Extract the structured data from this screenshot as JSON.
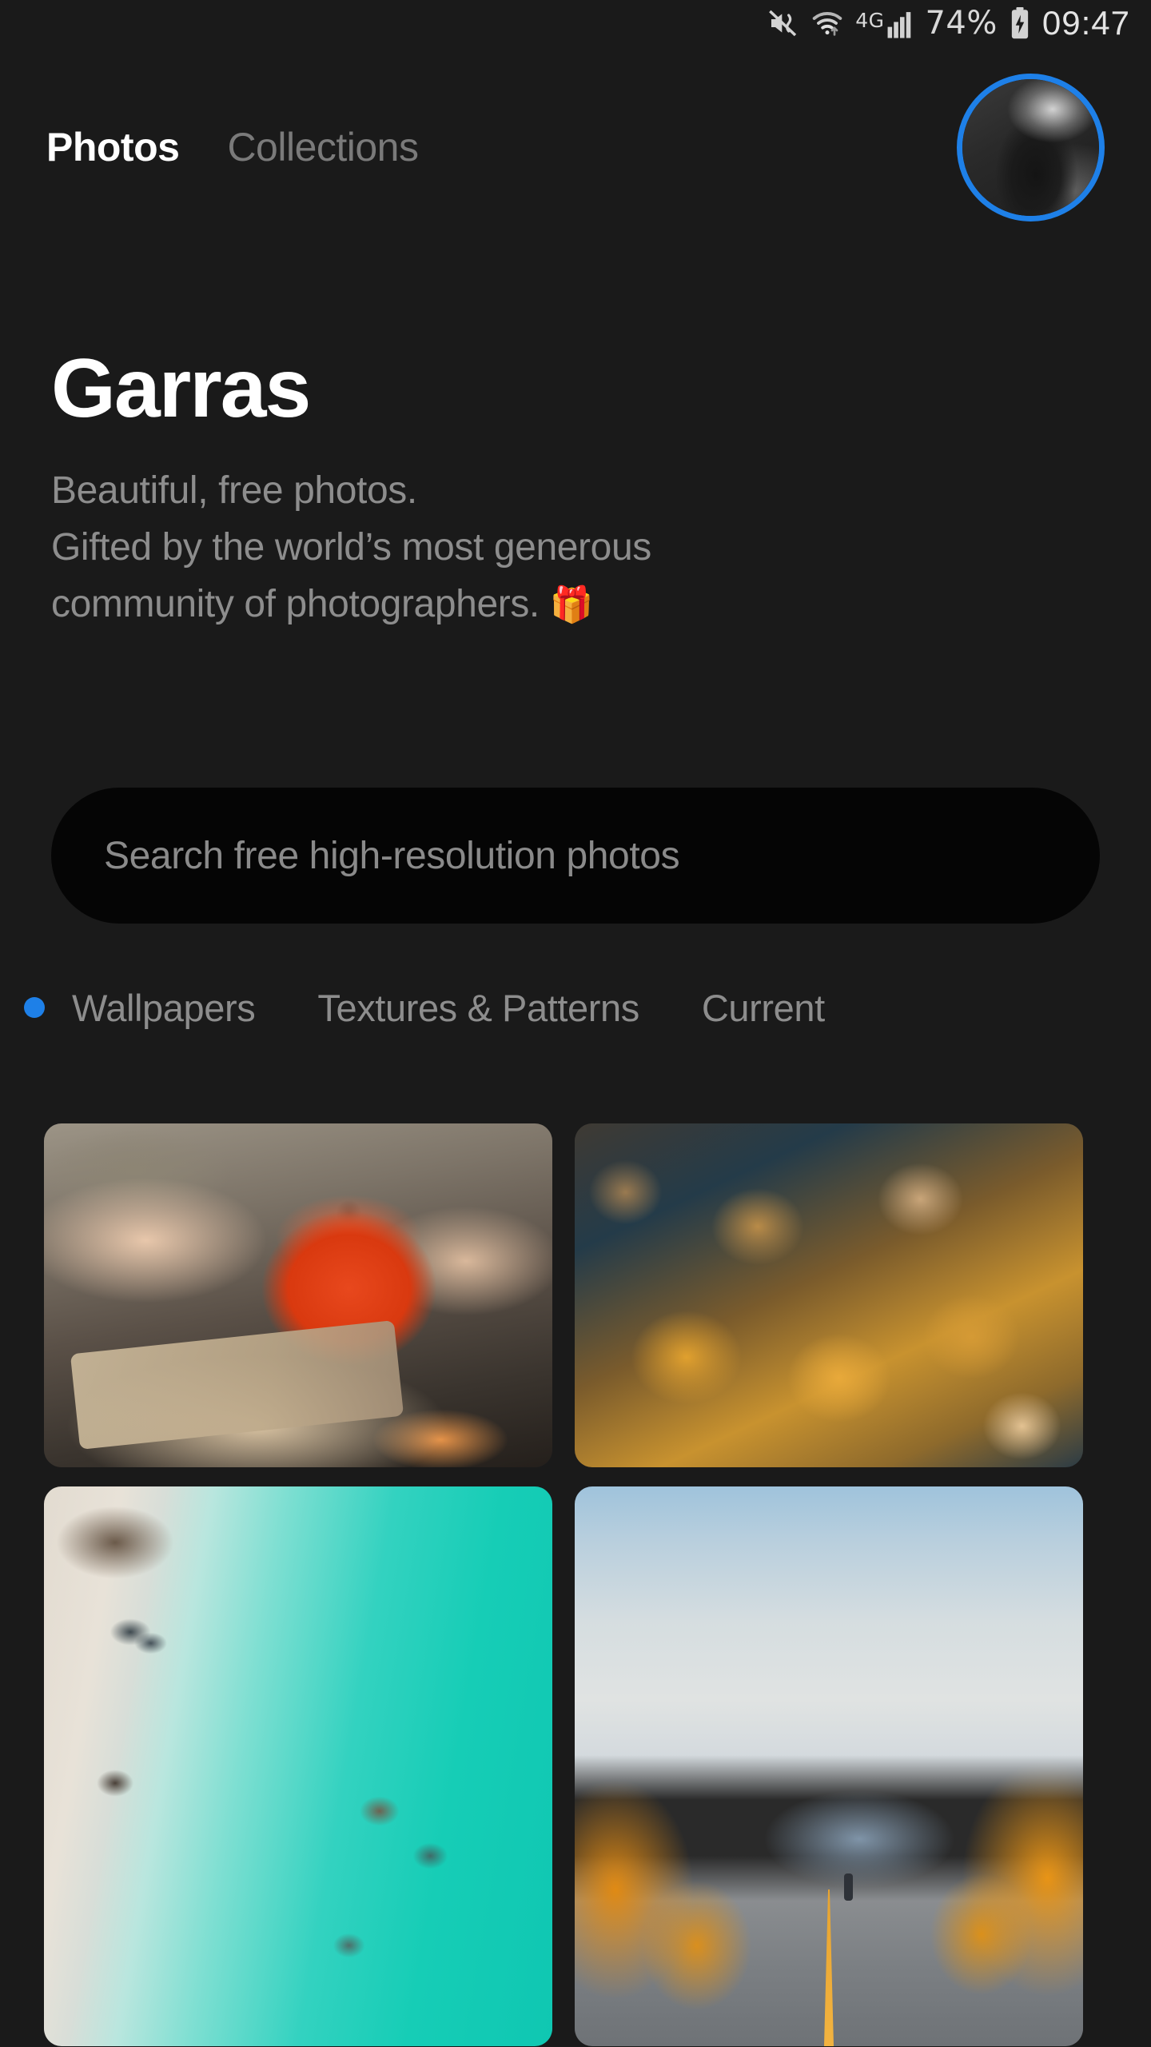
{
  "status_bar": {
    "mute_icon": "mute-vibrate-icon",
    "wifi_icon": "wifi-icon",
    "network_label": "4G",
    "signal_icon": "signal-bars-icon",
    "battery_percent": "74%",
    "battery_icon": "battery-charging-icon",
    "time": "09:47"
  },
  "nav": {
    "tabs": [
      {
        "label": "Photos",
        "active": true
      },
      {
        "label": "Collections",
        "active": false
      }
    ],
    "avatar_name": "user-avatar",
    "avatar_ring_color": "#1e80e8"
  },
  "hero": {
    "title": "Garras",
    "subtitle_line1": "Beautiful, free photos.",
    "subtitle_line2": "Gifted by the world’s most generous",
    "subtitle_line3": "community of photographers.",
    "gift_emoji": "🎁"
  },
  "search": {
    "placeholder": "Search free high-resolution photos",
    "value": ""
  },
  "categories": {
    "active_dot_color": "#1e80e8",
    "items": [
      {
        "label": "Wallpapers",
        "active": true
      },
      {
        "label": "Textures & Patterns",
        "active": false
      },
      {
        "label": "Current",
        "active": false
      }
    ]
  },
  "grid": {
    "photos": [
      {
        "alt": "Hands cooking with red dutch oven pot on cutting board with carrots",
        "row": 1
      },
      {
        "alt": "Golden autumn leaves scattered on dark ground",
        "row": 1
      },
      {
        "alt": "Aerial view of turquoise sea, white sand beach and stingrays",
        "row": 2
      },
      {
        "alt": "Mountain highway through autumn larch forest with walker",
        "row": 2
      }
    ]
  },
  "theme": {
    "background": "#1a1a1a",
    "search_background": "#050505",
    "accent": "#1e80e8",
    "text_primary": "#ffffff",
    "text_muted": "#8d8d8d"
  }
}
